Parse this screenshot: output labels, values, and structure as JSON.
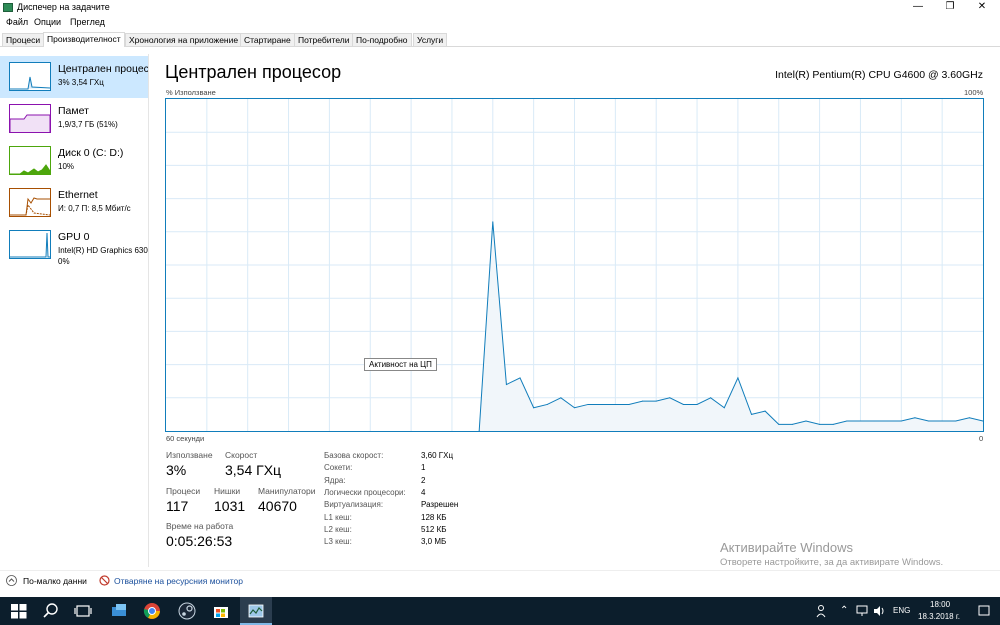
{
  "window": {
    "title": "Диспечер на задачите",
    "buttons": {
      "minimize": "—",
      "restore": "❐",
      "close": "✕"
    }
  },
  "menu": [
    "Файл",
    "Опции",
    "Преглед"
  ],
  "tabs": [
    "Процеси",
    "Производителност",
    "Хронология на приложение",
    "Стартиране",
    "Потребители",
    "По-подробно",
    "Услуги"
  ],
  "sidebar": [
    {
      "name": "Централен процесор",
      "sub": "3% 3,54 ГХц",
      "color": "#117dbb"
    },
    {
      "name": "Памет",
      "sub": "1,9/3,7 ГБ (51%)",
      "color": "#8b12ae"
    },
    {
      "name": "Диск 0 (C: D:)",
      "sub": "10%",
      "color": "#4da60c"
    },
    {
      "name": "Ethernet",
      "sub": "И: 0,7 П: 8,5 Мбит/с",
      "color": "#a74f01"
    },
    {
      "name": "GPU 0",
      "sub": "Intel(R) HD Graphics 630",
      "sub2": "0%",
      "color": "#117dbb"
    }
  ],
  "main": {
    "title": "Централен процесор",
    "cpu_model": "Intel(R) Pentium(R) CPU G4600 @ 3.60GHz",
    "y_label": "% Използване",
    "y_max": "100%",
    "x_left": "60 секунди",
    "x_right": "0",
    "tooltip": "Активност на ЦП"
  },
  "chart_data": {
    "type": "area",
    "x": [
      60,
      59,
      58,
      57,
      56,
      55,
      54,
      53,
      52,
      51,
      50,
      49,
      48,
      47,
      46,
      45,
      44,
      43,
      42,
      41,
      40,
      39,
      38,
      37,
      36,
      35,
      34,
      33,
      32,
      31,
      30,
      29,
      28,
      27,
      26,
      25,
      24,
      23,
      22,
      21,
      20,
      19,
      18,
      17,
      16,
      15,
      14,
      13,
      12,
      11,
      10,
      9,
      8,
      7,
      6,
      5,
      4,
      3,
      2,
      1,
      0
    ],
    "values": [
      null,
      null,
      null,
      null,
      null,
      null,
      null,
      null,
      null,
      null,
      null,
      null,
      null,
      null,
      null,
      null,
      null,
      null,
      null,
      null,
      null,
      null,
      null,
      0,
      63,
      14,
      16,
      7,
      8,
      10,
      7,
      8,
      8,
      8,
      8,
      9,
      9,
      10,
      8,
      8,
      10,
      7,
      16,
      5,
      6,
      2,
      2,
      3,
      2,
      2,
      3,
      3,
      3,
      3,
      3,
      4,
      3,
      3,
      3,
      4,
      3
    ],
    "ylim": [
      0,
      100
    ],
    "color": "#117dbb"
  },
  "stats": {
    "usage_label": "Използване",
    "usage_value": "3%",
    "speed_label": "Скорост",
    "speed_value": "3,54 ГХц",
    "processes_label": "Процеси",
    "processes_value": "117",
    "threads_label": "Нишки",
    "threads_value": "1031",
    "handles_label": "Манипулатори",
    "handles_value": "40670",
    "uptime_label": "Време на работа",
    "uptime_value": "0:05:26:53"
  },
  "details": [
    {
      "k": "Базова скорост:",
      "v": "3,60 ГХц"
    },
    {
      "k": "Сокети:",
      "v": "1"
    },
    {
      "k": "Ядра:",
      "v": "2"
    },
    {
      "k": "Логически процесори:",
      "v": "4"
    },
    {
      "k": "Виртуализация:",
      "v": "Разрешен"
    },
    {
      "k": "L1 кеш:",
      "v": "128 КБ"
    },
    {
      "k": "L2 кеш:",
      "v": "512 КБ"
    },
    {
      "k": "L3 кеш:",
      "v": "3,0 МБ"
    }
  ],
  "watermark": {
    "line1": "Активирайте Windows",
    "line2": "Отворете настройките, за да активирате Windows."
  },
  "bottom": {
    "fewer_details": "По-малко данни",
    "resource_monitor": "Отваряне на ресурсния монитор"
  },
  "taskbar": {
    "language": "ENG",
    "time": "18:00",
    "date": "18.3.2018 г."
  }
}
